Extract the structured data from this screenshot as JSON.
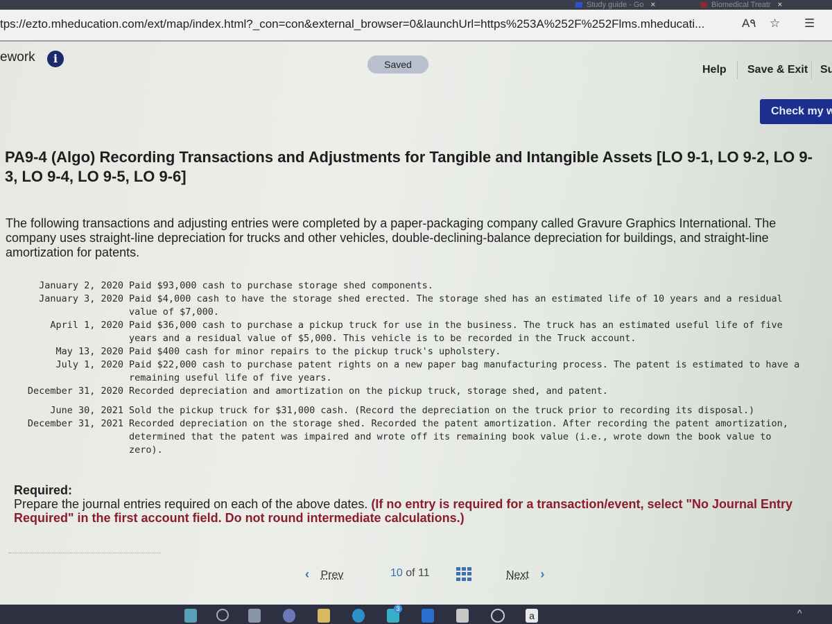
{
  "browser": {
    "tabs": [
      {
        "label": "Study guide - Go",
        "icon": "doc-icon"
      },
      {
        "label": "Biomedical Treatr",
        "icon": "site-icon"
      }
    ],
    "url": "tps://ezto.mheducation.com/ext/map/index.html?_con=con&external_browser=0&launchUrl=https%253A%252F%252Flms.mheducati...",
    "read_aloud_icon": "A٩",
    "favorite_icon": "☆",
    "favorites_list_icon": "☰"
  },
  "header": {
    "title": "ework",
    "info_icon": "i",
    "saved_label": "Saved",
    "help_label": "Help",
    "save_exit_label": "Save & Exit",
    "submit_label": "Su"
  },
  "check_button": "Check my w",
  "problem": {
    "title": "PA9-4 (Algo) Recording Transactions and Adjustments for Tangible and Intangible Assets [LO 9-1, LO 9-2, LO 9-3, LO 9-4, LO 9-5, LO 9-6]",
    "intro": "The following transactions and adjusting entries were completed by a paper-packaging company called Gravure Graphics International. The company uses straight-line depreciation for trucks and other vehicles, double-declining-balance depreciation for buildings, and straight-line amortization for patents.",
    "transactions_2020": [
      {
        "date": "January 2, 2020",
        "desc": "Paid $93,000 cash to purchase storage shed components."
      },
      {
        "date": "January 3, 2020",
        "desc": "Paid $4,000 cash to have the storage shed erected. The storage shed has an estimated life of 10 years and a residual value of $7,000."
      },
      {
        "date": "April 1, 2020",
        "desc": "Paid $36,000 cash to purchase a pickup truck for use in the business. The truck has an estimated useful life of five years and a residual value of $5,000. This vehicle is to be recorded in the Truck account."
      },
      {
        "date": "May 13, 2020",
        "desc": "Paid $400 cash for minor repairs to the pickup truck's upholstery."
      },
      {
        "date": "July 1, 2020",
        "desc": "Paid $22,000 cash to purchase patent rights on a new paper bag manufacturing process. The patent is estimated to have a remaining useful life of five years."
      },
      {
        "date": "December 31, 2020",
        "desc": "Recorded depreciation and amortization on the pickup truck, storage shed, and patent."
      }
    ],
    "transactions_2021": [
      {
        "date": "June 30, 2021",
        "desc": "Sold the pickup truck for $31,000 cash. (Record the depreciation on the truck prior to recording its disposal.)"
      },
      {
        "date": "December 31, 2021",
        "desc": "Recorded depreciation on the storage shed. Recorded the patent amortization. After recording the patent amortization, determined that the patent was impaired and wrote off its remaining book value (i.e., wrote down the book value to zero)."
      }
    ],
    "required_label": "Required:",
    "required_text": "Prepare the journal entries required on each of the above dates.",
    "required_note": "(If no entry is required for a transaction/event, select \"No Journal Entry Required\" in the first account field. Do not round intermediate calculations.)"
  },
  "pager": {
    "prev_label": "Prev",
    "current": "10",
    "of_label": "of",
    "total": "11",
    "next_label": "Next"
  },
  "taskbar": {
    "mail_badge": "3",
    "amazon_label": "a"
  }
}
